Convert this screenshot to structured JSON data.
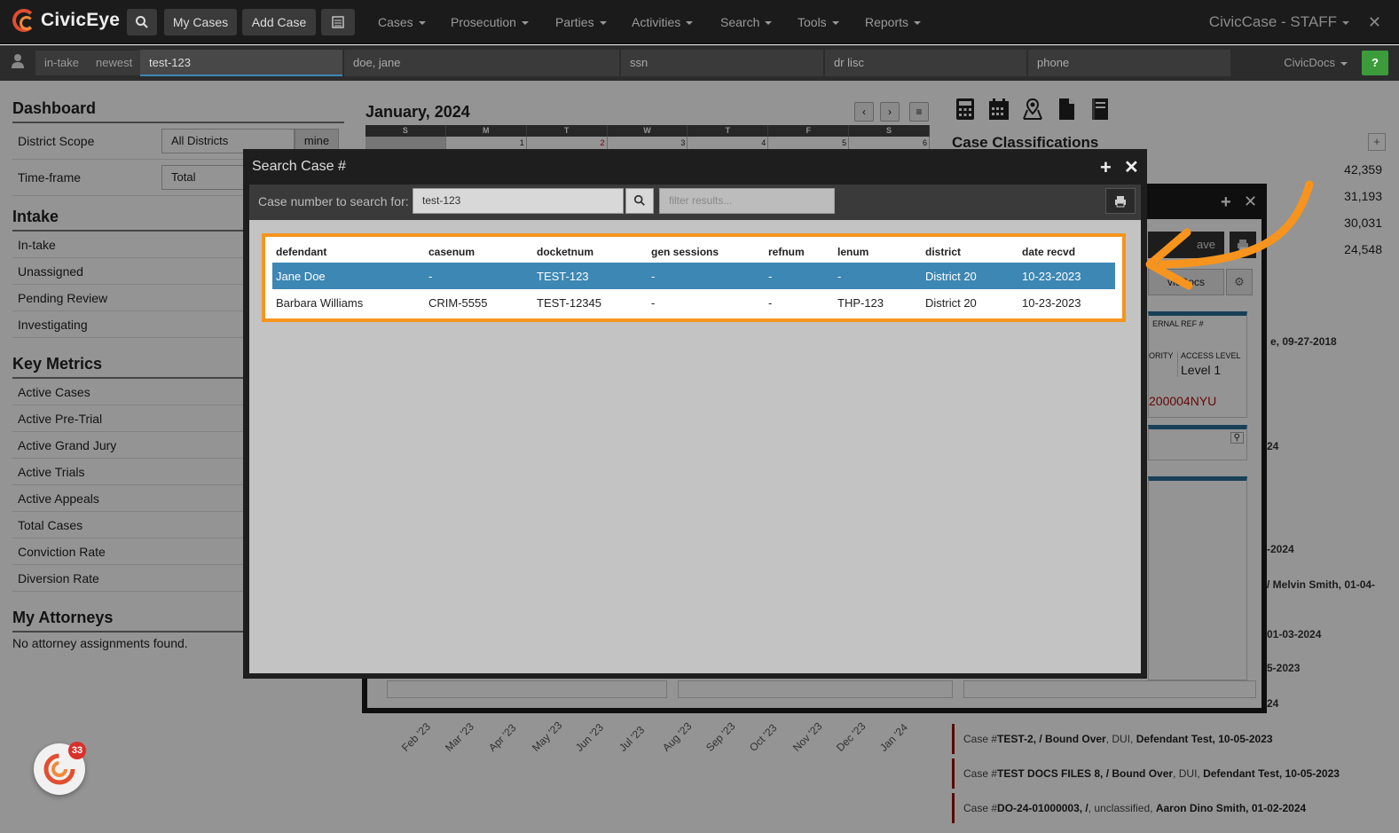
{
  "app": {
    "name": "CivicEye",
    "instance": "CivicCase - STAFF",
    "my_cases": "My Cases",
    "add_case": "Add Case"
  },
  "nav": [
    "Cases",
    "Prosecution",
    "Parties",
    "Activities",
    "Search",
    "Tools",
    "Reports"
  ],
  "quickbar": {
    "intake": "in-take",
    "newest": "newest",
    "case_value": "test-123",
    "name_value": "doe, jane",
    "ssn_placeholder": "ssn",
    "dl_placeholder": "dr lisc",
    "phone_placeholder": "phone",
    "civicdocs": "CivicDocs",
    "help": "?"
  },
  "dashboard": {
    "title": "Dashboard",
    "district_scope_label": "District Scope",
    "district_scope_value": "All Districts",
    "mine": "mine",
    "timeframe_label": "Time-frame",
    "timeframe_value": "Total"
  },
  "intake": {
    "title": "Intake",
    "items": [
      "In-take",
      "Unassigned",
      "Pending Review",
      "Investigating"
    ]
  },
  "metrics": {
    "title": "Key Metrics",
    "items": [
      "Active Cases",
      "Active Pre-Trial",
      "Active Grand Jury",
      "Active Trials",
      "Active Appeals",
      "Total Cases",
      "Conviction Rate",
      "Diversion Rate"
    ]
  },
  "attorneys": {
    "title": "My Attorneys",
    "note": "No attorney assignments found."
  },
  "calendar": {
    "title": "January, 2024",
    "days": [
      "S",
      "M",
      "T",
      "W",
      "T",
      "F",
      "S"
    ],
    "dates": [
      "",
      "1",
      "2",
      "3",
      "4",
      "5",
      "6"
    ]
  },
  "classifications": {
    "title": "Case Classifications",
    "plus": "+",
    "values": [
      "42,359",
      "31,193",
      "30,031",
      "24,548"
    ]
  },
  "feed": [
    {
      "prefix": "Case #",
      "case": "TEST-2, / Bound Over",
      "mid": ", DUI, ",
      "name": "Defendant Test, 10-05-2023"
    },
    {
      "prefix": "Case #",
      "case": "TEST DOCS FILES 8, / Bound Over",
      "mid": ", DUI, ",
      "name": "Defendant Test, 10-05-2023"
    },
    {
      "prefix": "Case #",
      "case": "DO-24-01000003, /",
      "mid": ", unclassified, ",
      "name": "Aaron Dino Smith, 01-02-2024"
    }
  ],
  "months": [
    "Feb '23",
    "Mar '23",
    "Apr '23",
    "May '23",
    "Jun '23",
    "Jul '23",
    "Aug '23",
    "Sep '23",
    "Oct '23",
    "Nov '23",
    "Dec '23",
    "Jan '24"
  ],
  "back_panel": {
    "save": "ave",
    "civicdocs": "vicDocs",
    "ref_label": "ERNAL REF #",
    "priority_label": "ORITY",
    "access_label": "ACCESS LEVEL",
    "access_value": "Level 1",
    "case_code": "200004NYU",
    "right_texts": [
      "e, 09-27-2018",
      "24",
      "-2024",
      "/ Melvin Smith, 01-04-",
      "01-03-2024",
      "5-2023",
      "24"
    ]
  },
  "modal": {
    "title": "Search Case #",
    "label": "Case number to search for:",
    "search_value": "test-123",
    "filter_placeholder": "filter results...",
    "columns": [
      "defendant",
      "casenum",
      "docketnum",
      "gen sessions",
      "refnum",
      "lenum",
      "district",
      "date recvd"
    ],
    "rows": [
      [
        "Jane Doe",
        "-",
        "TEST-123",
        "-",
        "-",
        "-",
        "District 20",
        "10-23-2023"
      ],
      [
        "Barbara Williams",
        "CRIM-5555",
        "TEST-12345",
        "-",
        "-",
        "THP-123",
        "District 20",
        "10-23-2023"
      ]
    ]
  },
  "chat": {
    "badge": "33"
  },
  "colors": {
    "accent": "#f7941d",
    "selected_row": "#3d87b4",
    "logo": "#e24e2f",
    "help": "#3c9c3c"
  }
}
